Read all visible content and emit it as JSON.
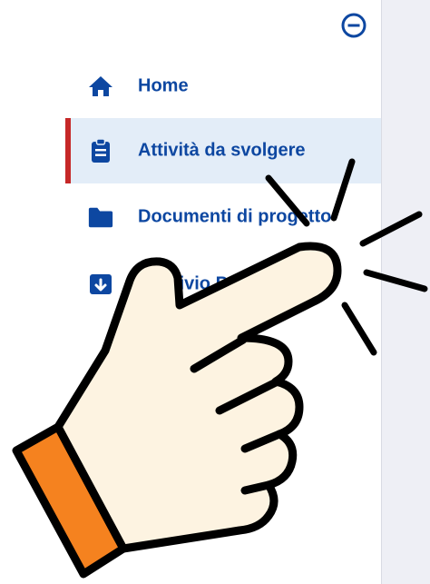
{
  "sidebar": {
    "collapse_icon": "minus-circle-icon",
    "items": [
      {
        "label": "Home",
        "icon": "home-icon",
        "active": false
      },
      {
        "label": "Attività  da svolgere",
        "icon": "clipboard-icon",
        "active": true
      },
      {
        "label": "Documenti di progetto",
        "icon": "folder-icon",
        "active": false
      },
      {
        "label": "Archivio Pr",
        "icon": "archive-icon",
        "active": false
      }
    ]
  },
  "overlay": {
    "icon": "pointing-hand-click-icon"
  },
  "colors": {
    "primary": "#0d47a1",
    "active_bg": "#e3edf8",
    "active_bar": "#c62828",
    "pane_bg": "#eeeff5",
    "hand_fill": "#fdf3e1",
    "cuff": "#f5821f"
  }
}
